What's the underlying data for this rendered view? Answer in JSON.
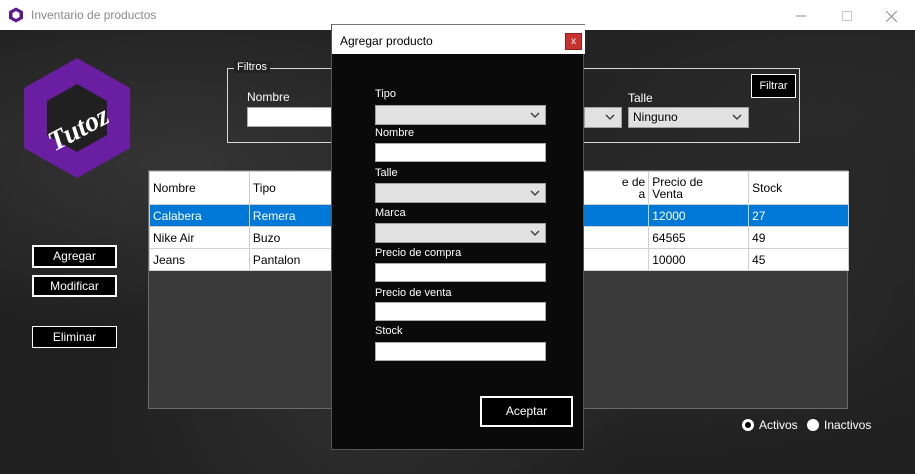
{
  "window": {
    "title": "Inventario de productos"
  },
  "logo": {
    "text": "Tutoz",
    "color": "#6a1fa2"
  },
  "filters": {
    "legend": "Filtros",
    "nombre_label": "Nombre",
    "talle_label": "Talle",
    "talle_value": "Ninguno",
    "filter_button": "Filtrar"
  },
  "actions": {
    "add": "Agregar",
    "modify": "Modificar",
    "delete": "Eliminar"
  },
  "grid": {
    "columns": [
      "Nombre",
      "Tipo",
      "Precio de Compra",
      "Precio de Venta",
      "Stock"
    ],
    "visible_headers": {
      "nombre": "Nombre",
      "tipo": "Tipo",
      "compra_partial": "e de\na",
      "venta": "Precio de\nVenta",
      "stock": "Stock"
    },
    "rows": [
      {
        "nombre": "Calabera",
        "tipo": "Remera",
        "venta": "12000",
        "stock": "27",
        "selected": true
      },
      {
        "nombre": "Nike Air",
        "tipo": "Buzo",
        "venta": "64565",
        "stock": "49",
        "selected": false
      },
      {
        "nombre": "Jeans",
        "tipo": "Pantalon",
        "venta": "10000",
        "stock": "45",
        "selected": false
      }
    ],
    "selection_color": "#0078d7"
  },
  "radios": {
    "activos": "Activos",
    "inactivos": "Inactivos",
    "checked": "activos"
  },
  "dialog": {
    "title": "Agregar producto",
    "close": "x",
    "tipo_label": "Tipo",
    "nombre_label": "Nombre",
    "talle_label": "Talle",
    "marca_label": "Marca",
    "precio_compra_label": "Precio de compra",
    "precio_venta_label": "Precio de venta",
    "stock_label": "Stock",
    "accept_button": "Aceptar",
    "close_color": "#c8312f"
  }
}
